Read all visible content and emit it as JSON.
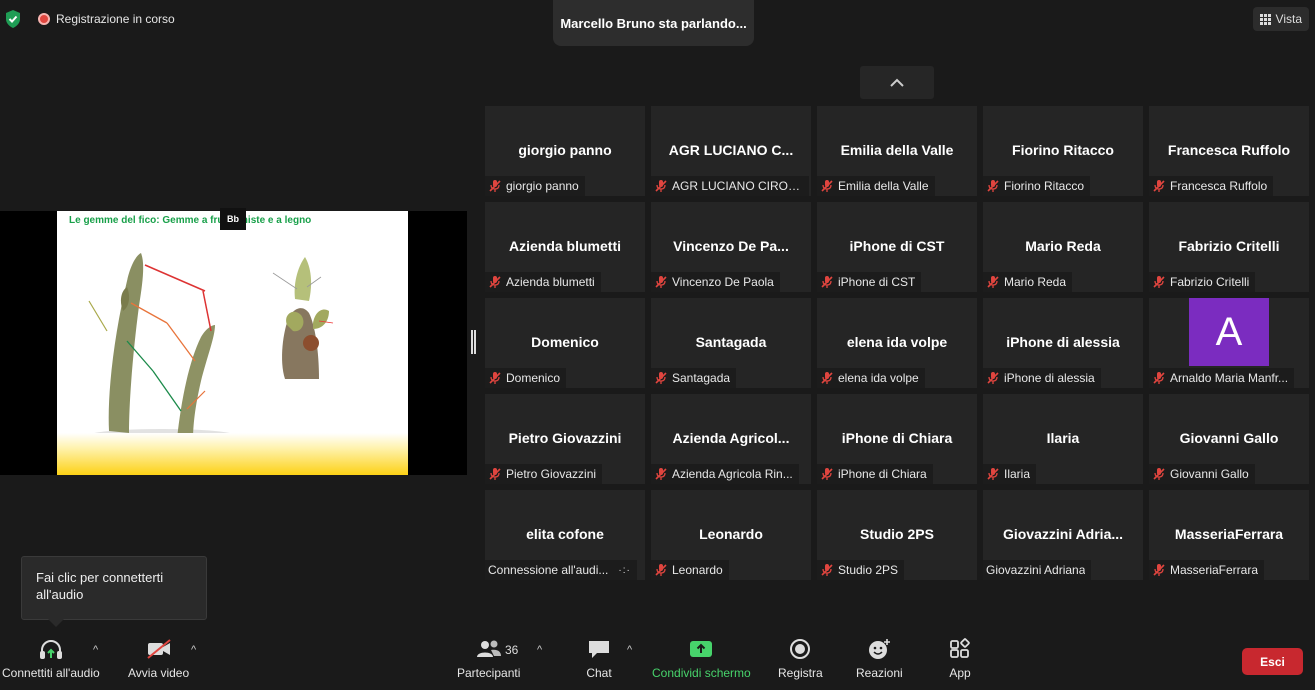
{
  "top": {
    "recording_label": "Registrazione in corso",
    "speaking_label": "Marcello Bruno sta parlando...",
    "view_label": "Vista"
  },
  "slide": {
    "title": "Le gemme del fico:  Gemme a frutto miste e a legno",
    "share_tag": "Bb"
  },
  "gallery": {
    "tiles": [
      {
        "name": "giorgio panno",
        "label": "giorgio panno",
        "muted": true
      },
      {
        "name": "AGR LUCIANO C...",
        "label": "AGR LUCIANO CIROL...",
        "muted": true
      },
      {
        "name": "Emilia della Valle",
        "label": "Emilia della Valle",
        "muted": true
      },
      {
        "name": "Fiorino Ritacco",
        "label": "Fiorino Ritacco",
        "muted": true
      },
      {
        "name": "Francesca Ruffolo",
        "label": "Francesca Ruffolo",
        "muted": true
      },
      {
        "name": "Azienda blumetti",
        "label": "Azienda blumetti",
        "muted": true
      },
      {
        "name": "Vincenzo  De  Pa...",
        "label": "Vincenzo De Paola",
        "muted": true
      },
      {
        "name": "iPhone di CST",
        "label": "iPhone di CST",
        "muted": true
      },
      {
        "name": "Mario Reda",
        "label": "Mario Reda",
        "muted": true
      },
      {
        "name": "Fabrizio Critelli",
        "label": "Fabrizio Critelli",
        "muted": true
      },
      {
        "name": "Domenico",
        "label": "Domenico",
        "muted": true
      },
      {
        "name": "Santagada",
        "label": "Santagada",
        "muted": true
      },
      {
        "name": "elena ida volpe",
        "label": "elena ida volpe",
        "muted": true
      },
      {
        "name": "iPhone di alessia",
        "label": "iPhone di alessia",
        "muted": true
      },
      {
        "name": "",
        "avatar": "A",
        "label": "Arnaldo Maria Manfr...",
        "muted": true
      },
      {
        "name": "Pietro Giovazzini",
        "label": "Pietro Giovazzini",
        "muted": true
      },
      {
        "name": "Azienda  Agricol...",
        "label": "Azienda Agricola Rin...",
        "muted": true
      },
      {
        "name": "iPhone di Chiara",
        "label": "iPhone di Chiara",
        "muted": true
      },
      {
        "name": "Ilaria",
        "label": "Ilaria",
        "muted": true
      },
      {
        "name": "Giovanni Gallo",
        "label": "Giovanni Gallo",
        "muted": true
      },
      {
        "name": "elita cofone",
        "label": "Connessione all'audi...",
        "muted": false,
        "connecting": true
      },
      {
        "name": "Leonardo",
        "label": "Leonardo",
        "muted": true
      },
      {
        "name": "Studio 2PS",
        "label": "Studio 2PS",
        "muted": true
      },
      {
        "name": "Giovazzini  Adria...",
        "label": "Giovazzini Adriana",
        "muted": false
      },
      {
        "name": "MasseriaFerrara",
        "label": "MasseriaFerrara",
        "muted": true
      }
    ]
  },
  "tooltip": {
    "text": "Fai clic per connetterti all'audio"
  },
  "toolbar": {
    "audio_label": "Connettiti all'audio",
    "video_label": "Avvia video",
    "participants_label": "Partecipanti",
    "participants_count": "36",
    "chat_label": "Chat",
    "share_label": "Condividi schermo",
    "record_label": "Registra",
    "reactions_label": "Reazioni",
    "apps_label": "App",
    "exit_label": "Esci"
  },
  "colors": {
    "background": "#1a1a1a",
    "tile": "#252525",
    "share_green": "#47d36b",
    "exit_red": "#c8282f",
    "mute_red": "#e0453f",
    "avatar_purple": "#7b2cc0"
  }
}
